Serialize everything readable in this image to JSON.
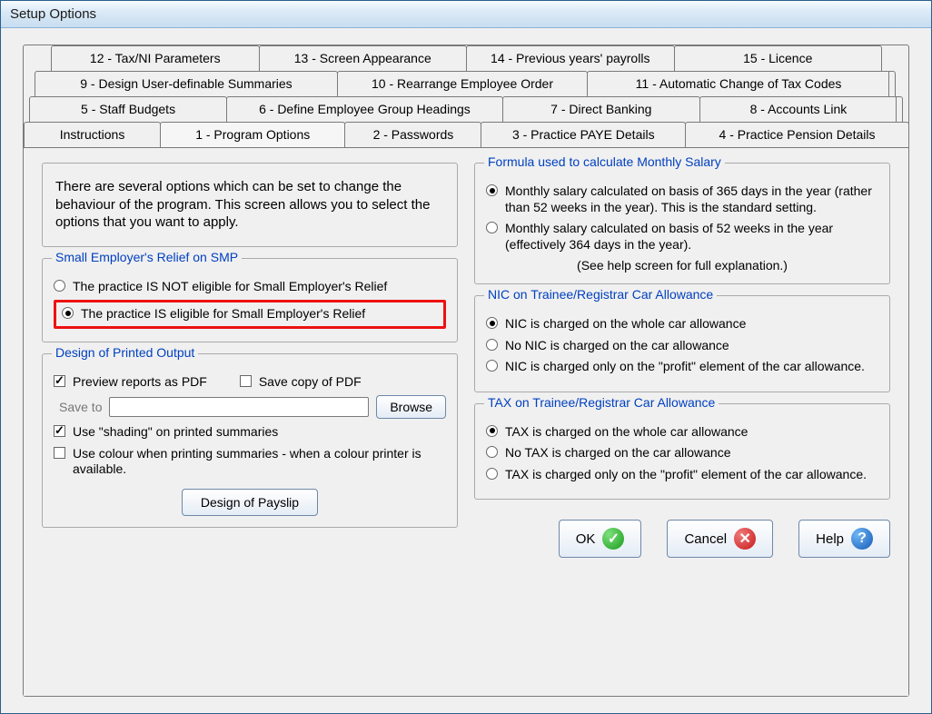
{
  "window": {
    "title": "Setup Options"
  },
  "tabs": {
    "row1": [
      "12 - Tax/NI Parameters",
      "13 - Screen Appearance",
      "14 - Previous years' payrolls",
      "15 - Licence"
    ],
    "row2": [
      "9 - Design User-definable Summaries",
      "10 - Rearrange Employee Order",
      "11 - Automatic Change of Tax Codes"
    ],
    "row3": [
      "5 - Staff  Budgets",
      "6 - Define Employee Group Headings",
      "7 - Direct Banking",
      "8 - Accounts Link"
    ],
    "row4": [
      "Instructions",
      "1 - Program Options",
      "2 - Passwords",
      "3 - Practice PAYE Details",
      "4 - Practice Pension Details"
    ],
    "active": "1 - Program Options"
  },
  "intro": "There are several options which can be set to change the behaviour of the program.  This screen allows you to select the options that you want to apply.",
  "smp": {
    "legend": "Small Employer's Relief on SMP",
    "opt_not": "The practice IS NOT eligible for Small Employer's Relief",
    "opt_is": "The practice IS eligible for Small Employer's Relief",
    "selected": "is"
  },
  "printed": {
    "legend": "Design of Printed Output",
    "preview_pdf": "Preview reports as PDF",
    "preview_pdf_checked": true,
    "save_copy": "Save copy of PDF",
    "save_copy_checked": false,
    "save_to_label": "Save to",
    "browse": "Browse",
    "shading": "Use \"shading\" on printed summaries",
    "shading_checked": true,
    "colour": "Use colour when printing summaries - when a colour printer is available.",
    "colour_checked": false,
    "design_payslip": "Design of Payslip"
  },
  "formula": {
    "legend": "Formula used to calculate Monthly Salary",
    "opt365": "Monthly salary calculated on basis of 365 days in the year (rather than 52 weeks in the year).  This is the standard setting.",
    "opt52": "Monthly salary calculated on basis of 52 weeks in the year (effectively 364 days in the year).",
    "selected": "365",
    "help_note": "(See help screen for full explanation.)"
  },
  "nic": {
    "legend": "NIC on Trainee/Registrar  Car Allowance",
    "whole": "NIC is charged on the whole car allowance",
    "none": "No NIC is charged on the car allowance",
    "profit": "NIC is charged only on the \"profit\" element of the car allowance.",
    "selected": "whole"
  },
  "tax": {
    "legend": "TAX on Trainee/Registrar  Car Allowance",
    "whole": "TAX is charged on the whole car allowance",
    "none": "No TAX is charged on the car allowance",
    "profit": "TAX is charged only on the \"profit\" element of the car allowance.",
    "selected": "whole"
  },
  "buttons": {
    "ok": "OK",
    "cancel": "Cancel",
    "help": "Help"
  }
}
